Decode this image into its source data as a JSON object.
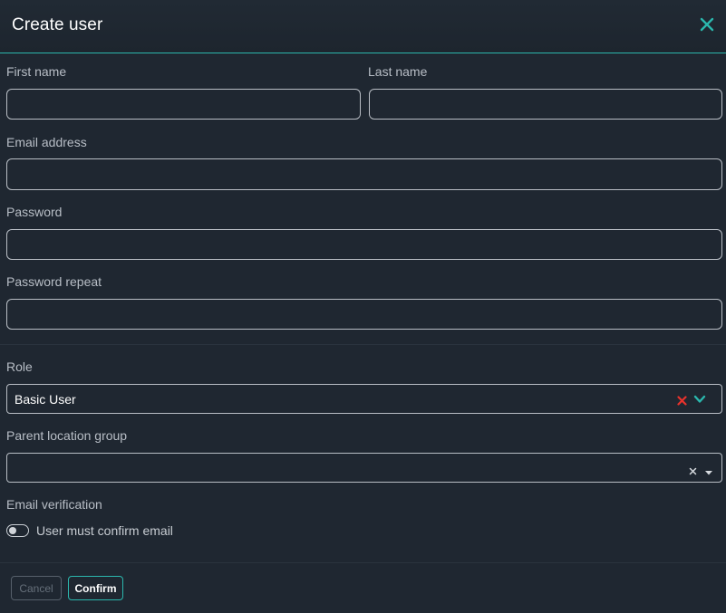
{
  "dialog": {
    "title": "Create user",
    "close_icon": "close-icon"
  },
  "form": {
    "first_name": {
      "label": "First name",
      "value": "",
      "placeholder": ""
    },
    "last_name": {
      "label": "Last name",
      "value": "",
      "placeholder": ""
    },
    "email": {
      "label": "Email address",
      "value": "",
      "placeholder": ""
    },
    "password": {
      "label": "Password",
      "value": "",
      "placeholder": ""
    },
    "password_repeat": {
      "label": "Password repeat",
      "value": "",
      "placeholder": ""
    },
    "role": {
      "label": "Role",
      "selected": "Basic User",
      "clear_icon": "clear-icon",
      "dropdown_icon": "chevron-down-icon"
    },
    "parent_location_group": {
      "label": "Parent location group",
      "selected": "",
      "clear_icon": "clear-icon",
      "dropdown_icon": "caret-down-icon"
    },
    "email_verification": {
      "label": "Email verification",
      "toggle_label": "User must confirm email",
      "enabled": false
    }
  },
  "footer": {
    "cancel_label": "Cancel",
    "confirm_label": "Confirm"
  },
  "colors": {
    "background": "#1f2731",
    "accent": "#2bb7ad",
    "clear_red": "#e8322c",
    "border": "#b9bec5"
  }
}
